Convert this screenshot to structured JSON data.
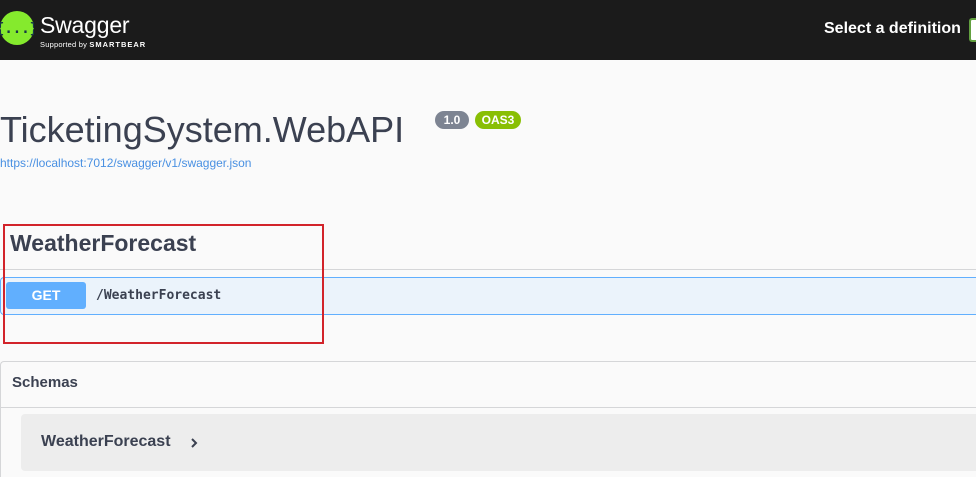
{
  "header": {
    "logo_name": "Swagger",
    "logo_sub_prefix": "Supported by",
    "logo_sub_brand": "SMARTBEAR",
    "select_definition_label": "Select a definition",
    "colors": {
      "bar": "#1b1b1b",
      "logo": "#85ea2d",
      "select_border": "#62a03f"
    }
  },
  "info": {
    "title": "TicketingSystem.WebAPI",
    "version_badge": "1.0",
    "oas_badge": "OAS3",
    "spec_url": "https://localhost:7012/swagger/v1/swagger.json"
  },
  "operations": {
    "tag": "WeatherForecast",
    "items": [
      {
        "method": "GET",
        "path": "/WeatherForecast",
        "color": "#61affe"
      }
    ]
  },
  "schemas": {
    "title": "Schemas",
    "models": [
      {
        "name": "WeatherForecast",
        "icon": "chevron-right-icon"
      }
    ]
  },
  "annotation": {
    "color": "#d2232a"
  }
}
